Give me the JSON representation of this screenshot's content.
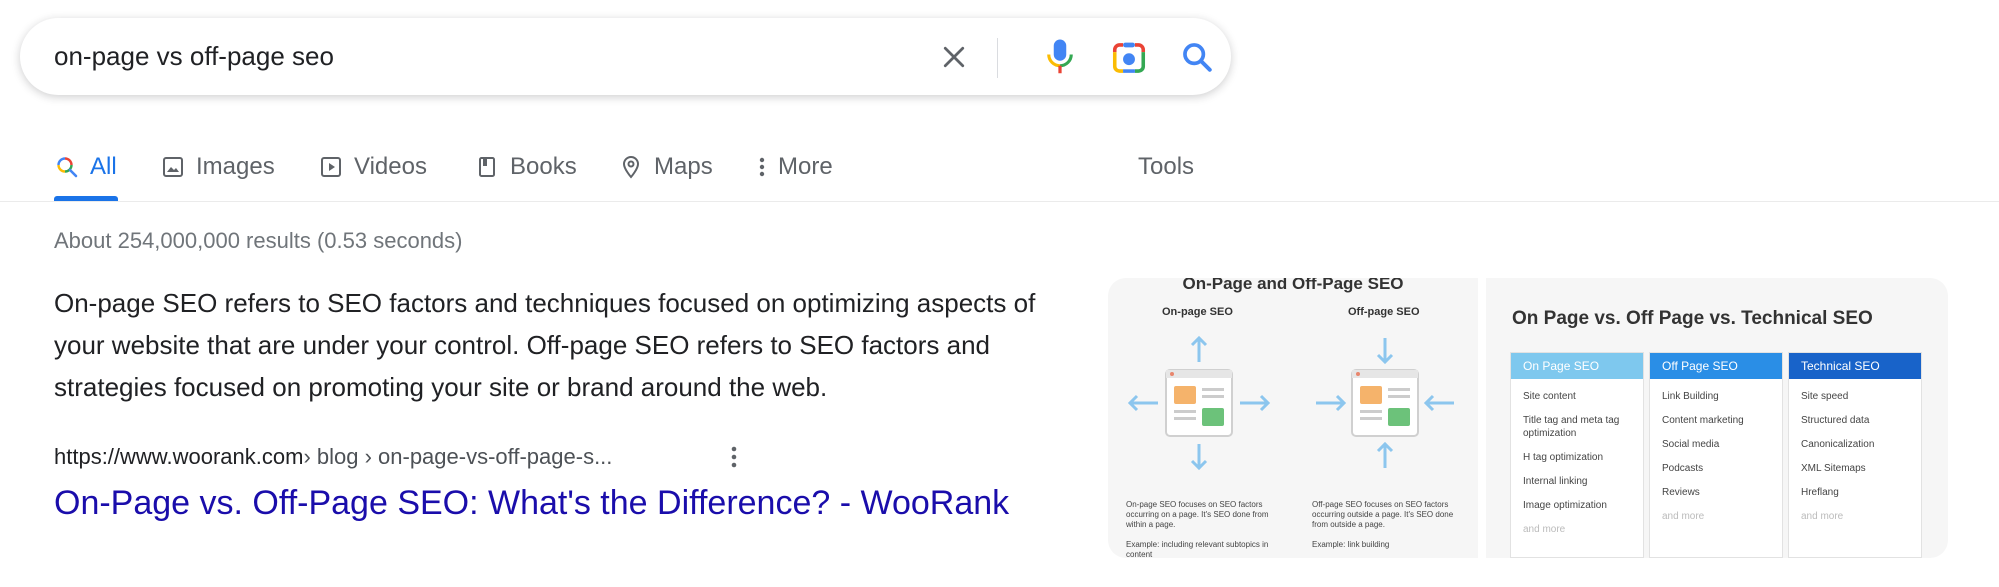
{
  "search": {
    "query": "on-page vs off-page seo"
  },
  "colors": {
    "accent": "#1a73e8",
    "link": "#1a0dab",
    "muted": "#70757a",
    "mic_blue": "#4285f4",
    "mic_red": "#ea4335",
    "mic_yellow": "#fbbc04",
    "mic_green": "#34a853"
  },
  "tabs": [
    {
      "label": "All",
      "icon": "search-multicolor-icon",
      "active": true
    },
    {
      "label": "Images",
      "icon": "image-icon"
    },
    {
      "label": "Videos",
      "icon": "play-icon"
    },
    {
      "label": "Books",
      "icon": "book-icon"
    },
    {
      "label": "Maps",
      "icon": "map-pin-icon"
    },
    {
      "label": "More",
      "icon": "vertical-dots-icon"
    }
  ],
  "tools_label": "Tools",
  "result_stats": "About 254,000,000 results (0.53 seconds)",
  "snippet": {
    "text": "On-page SEO refers to SEO factors and techniques focused on optimizing aspects of your website that are under your control. Off-page SEO refers to SEO factors and strategies focused on promoting your site or brand around the web."
  },
  "result": {
    "domain": "https://www.woorank.com",
    "path": " › blog › on-page-vs-off-page-s...",
    "title": "On-Page vs. Off-Page SEO: What's the Difference? - WooRank"
  },
  "images": {
    "card1": {
      "title": "On-Page and Off-Page SEO",
      "left_label": "On-page SEO",
      "right_label": "Off-page SEO",
      "left_note": "On-page SEO focuses on SEO factors occurring on a page. It's SEO done from within a page.",
      "left_example": "Example: including relevant subtopics in content",
      "right_note": "Off-page SEO focuses on SEO factors occurring outside a page. It's SEO done from outside a page.",
      "right_example": "Example: link building"
    },
    "card2": {
      "title": "On Page vs. Off Page vs. Technical SEO",
      "columns": [
        {
          "header": "On Page SEO",
          "color": "#7ec8ee",
          "items": [
            "Site content",
            "Title tag and meta tag optimization",
            "H tag optimization",
            "Internal linking",
            "Image optimization"
          ],
          "more": "and more"
        },
        {
          "header": "Off Page SEO",
          "color": "#2a8ee6",
          "items": [
            "Link Building",
            "Content marketing",
            "Social media",
            "Podcasts",
            "Reviews"
          ],
          "more": "and more"
        },
        {
          "header": "Technical SEO",
          "color": "#1863c9",
          "items": [
            "Site speed",
            "Structured data",
            "Canonicalization",
            "XML Sitemaps",
            "Hreflang"
          ],
          "more": "and more"
        }
      ]
    }
  }
}
